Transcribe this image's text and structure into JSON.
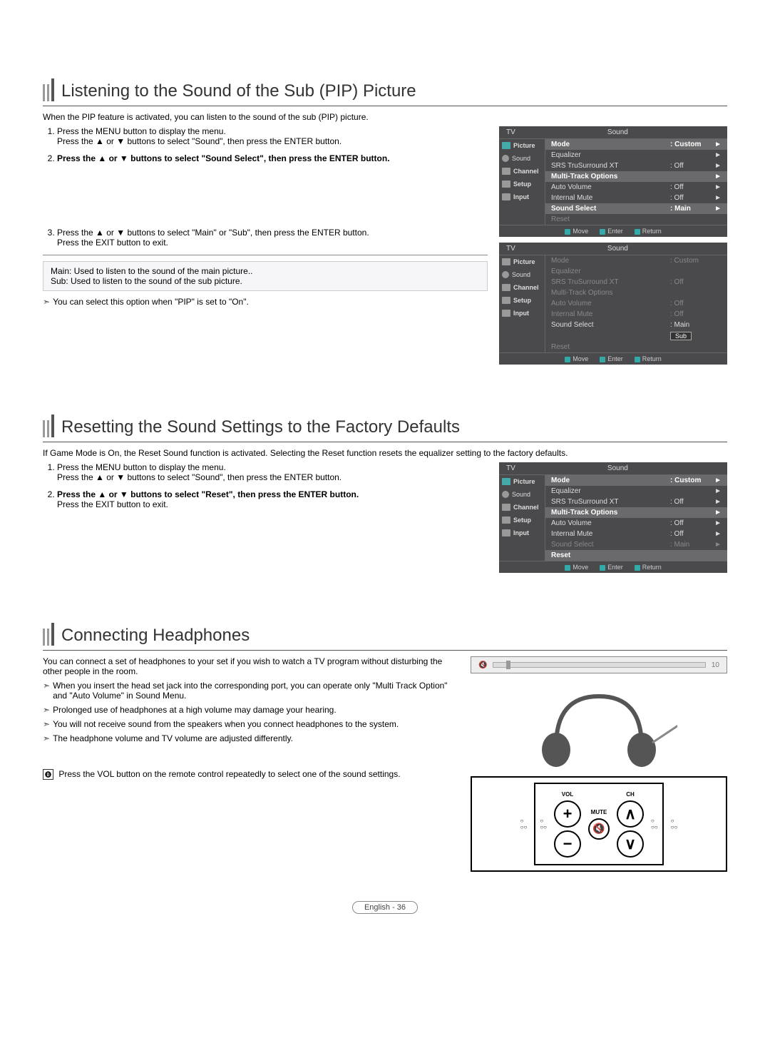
{
  "sections": {
    "pip": {
      "title": "Listening to the Sound of the Sub (PIP) Picture",
      "intro": "When the PIP feature is activated, you can listen to the sound of the sub (PIP) picture.",
      "step1a": "Press the MENU button to display the menu.",
      "step1b": "Press the ▲ or ▼ buttons to select \"Sound\", then press the ENTER button.",
      "step2": "Press the ▲ or ▼ buttons to select \"Sound Select\", then press the ENTER button.",
      "step3a": "Press the ▲ or ▼ buttons to select \"Main\" or \"Sub\", then press the ENTER button.",
      "step3b": "Press the EXIT button to exit.",
      "def_main": "Main:  Used to listen to the sound of the main picture..",
      "def_sub": "Sub:  Used to listen to the sound of the sub picture.",
      "note": "You can select this option when \"PIP\" is set to \"On\"."
    },
    "reset": {
      "title": "Resetting the Sound Settings to the Factory Defaults",
      "intro": "If Game Mode is On, the Reset Sound function is activated. Selecting the Reset function resets the equalizer setting to the factory defaults.",
      "step1a": "Press the MENU button to display the menu.",
      "step1b": "Press the ▲ or ▼ buttons to select \"Sound\", then press the ENTER button.",
      "step2a": "Press the ▲ or ▼ buttons to select \"Reset\", then press the ENTER button.",
      "step2b": "Press the EXIT button to exit."
    },
    "headphones": {
      "title": "Connecting Headphones",
      "intro": "You can connect a set of headphones to your set if you wish to watch a TV program without disturbing the other people in the room.",
      "note1": "When you insert the head set jack into the corresponding port, you can operate only \"Multi Track Option\" and \"Auto Volume\" in Sound Menu.",
      "note2": "Prolonged use of headphones at a high volume may damage your hearing.",
      "note3": "You will not receive sound from the speakers when you connect headphones to the system.",
      "note4": "The headphone volume and TV volume are adjusted differently.",
      "footnote": "Press the VOL button on the remote control repeatedly to select one of the sound settings."
    }
  },
  "osd": {
    "tv": "TV",
    "sound": "Sound",
    "nav": {
      "picture": "Picture",
      "sound": "Sound",
      "channel": "Channel",
      "setup": "Setup",
      "input": "Input"
    },
    "items": {
      "mode": "Mode",
      "mode_val": ": Custom",
      "equalizer": "Equalizer",
      "srs": "SRS TruSurround XT",
      "srs_val": ": Off",
      "multitrack": "Multi-Track Options",
      "autovol": "Auto Volume",
      "autovol_val": ": Off",
      "intmute": "Internal Mute",
      "intmute_val": ": Off",
      "soundsel": "Sound Select",
      "soundsel_val": ": Main",
      "reset": "Reset",
      "sub_val": "Sub"
    },
    "footer": {
      "move": "Move",
      "enter": "Enter",
      "return": "Return"
    }
  },
  "slider_value": "10",
  "panel": {
    "vol": "VOL",
    "ch": "CH",
    "mute": "MUTE"
  },
  "footer": "English - 36"
}
